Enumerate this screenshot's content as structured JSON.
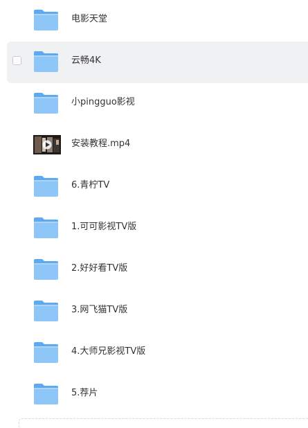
{
  "files": [
    {
      "name": "电影天堂",
      "type": "folder",
      "icon": "folder-icon"
    },
    {
      "name": "云畅4K",
      "type": "folder",
      "icon": "folder-icon",
      "hovered": true
    },
    {
      "name": "小pingguo影视",
      "type": "folder",
      "icon": "folder-icon"
    },
    {
      "name": "安装教程.mp4",
      "type": "video",
      "icon": "video-thumbnail"
    },
    {
      "name": "6.青柠TV",
      "type": "folder",
      "icon": "folder-icon"
    },
    {
      "name": "1.可可影视TV版",
      "type": "folder",
      "icon": "folder-icon"
    },
    {
      "name": "2.好好看TV版",
      "type": "folder",
      "icon": "folder-icon"
    },
    {
      "name": "3.网飞猫TV版",
      "type": "folder",
      "icon": "folder-icon"
    },
    {
      "name": "4.大师兄影视TV版",
      "type": "folder",
      "icon": "folder-icon"
    },
    {
      "name": "5.荐片",
      "type": "folder",
      "icon": "folder-icon"
    }
  ],
  "colors": {
    "folder_back": "#5fa9ee",
    "folder_front": "#8ec7f7",
    "hover_bg": "#f0f1f3",
    "text": "#333333"
  }
}
